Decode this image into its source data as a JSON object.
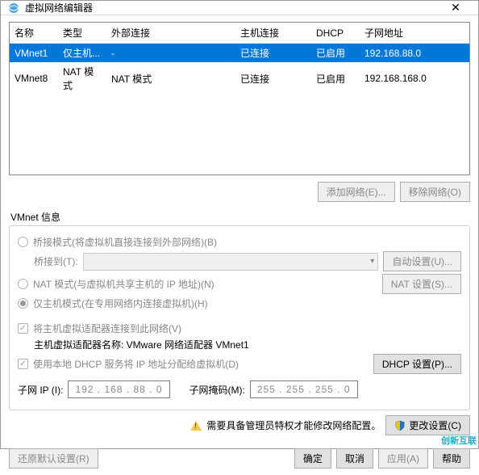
{
  "window": {
    "title": "虚拟网络编辑器"
  },
  "table": {
    "headers": {
      "name": "名称",
      "type": "类型",
      "ext": "外部连接",
      "host": "主机连接",
      "dhcp": "DHCP",
      "subnet": "子网地址"
    },
    "rows": [
      {
        "name": "VMnet1",
        "type": "仅主机...",
        "ext": "-",
        "host": "已连接",
        "dhcp": "已启用",
        "subnet": "192.168.88.0",
        "selected": true
      },
      {
        "name": "VMnet8",
        "type": "NAT 模式",
        "ext": "NAT 模式",
        "host": "已连接",
        "dhcp": "已启用",
        "subnet": "192.168.168.0",
        "selected": false
      }
    ]
  },
  "buttons": {
    "add_network": "添加网络(E)...",
    "remove_network": "移除网络(O)"
  },
  "vmnet_info": {
    "title": "VMnet 信息",
    "bridged": "桥接模式(将虚拟机直接连接到外部网络)(B)",
    "bridged_to_label": "桥接到(T):",
    "auto_settings": "自动设置(U)...",
    "nat": "NAT 模式(与虚拟机共享主机的 IP 地址)(N)",
    "nat_settings": "NAT 设置(S)...",
    "hostonly": "仅主机模式(在专用网络内连接虚拟机)(H)",
    "connect_host": "将主机虚拟适配器连接到此网络(V)",
    "adapter_label": "主机虚拟适配器名称: VMware 网络适配器 VMnet1",
    "use_dhcp": "使用本地 DHCP 服务将 IP 地址分配给虚拟机(D)",
    "dhcp_settings": "DHCP 设置(P)..."
  },
  "subnet": {
    "ip_label": "子网 IP (I):",
    "ip_value": "192 . 168 . 88 . 0",
    "mask_label": "子网掩码(M):",
    "mask_value": "255 . 255 . 255 . 0"
  },
  "notice": {
    "text": "需要具备管理员特权才能修改网络配置。",
    "change_settings": "更改设置(C)"
  },
  "footer": {
    "restore": "还原默认设置(R)",
    "ok": "确定",
    "cancel": "取消",
    "apply": "应用(A)",
    "help": "帮助"
  },
  "brand": "创新互联"
}
